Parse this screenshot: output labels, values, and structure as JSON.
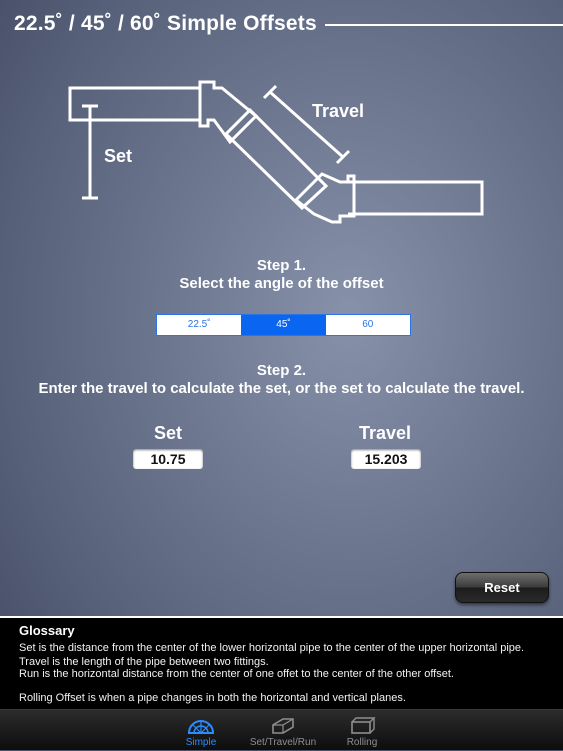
{
  "header": {
    "title": "22.5˚ / 45˚ / 60˚ Simple Offsets"
  },
  "diagram": {
    "set_label": "Set",
    "travel_label": "Travel"
  },
  "step1": {
    "title": "Step 1.",
    "instruction": "Select the angle of the offset"
  },
  "angle_selector": {
    "options": [
      "22.5˚",
      "45˚",
      "60"
    ],
    "selected": "45˚"
  },
  "step2": {
    "title": "Step 2.",
    "instruction": "Enter the travel to calculate the set, or the set to calculate the travel."
  },
  "fields": {
    "set": {
      "label": "Set",
      "value": "10.75"
    },
    "travel": {
      "label": "Travel",
      "value": "15.203"
    }
  },
  "reset_button": {
    "label": "Reset"
  },
  "glossary": {
    "title": "Glossary",
    "lines": [
      "Set is the distance from the center of the lower horizontal pipe to the center of the upper horizontal pipe.",
      "Travel is the length of the pipe between two fittings.",
      "Run is the horizontal distance from the center of one offet to the center of the other offset.",
      "",
      "Rolling Offset is when a pipe changes in both the horizontal and vertical planes."
    ]
  },
  "tab_bar": {
    "tabs": [
      {
        "label": "Simple",
        "icon": "protractor-icon",
        "active": true
      },
      {
        "label": "Set/Travel/Run",
        "icon": "offset-box-icon",
        "active": false
      },
      {
        "label": "Rolling",
        "icon": "rolling-box-icon",
        "active": false
      }
    ]
  },
  "colors": {
    "accent": "#0a66f0",
    "tab_active": "#2a8cff",
    "background_center": "#8791aa",
    "background_edge": "#404860"
  }
}
